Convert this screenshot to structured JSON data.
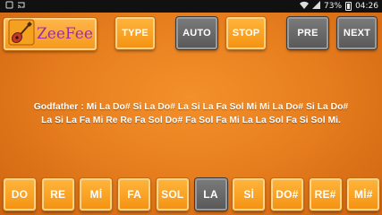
{
  "status_bar": {
    "battery": "73%",
    "time": "04:26"
  },
  "app": {
    "logo_text": "ZeeFee"
  },
  "toolbar": {
    "type_label": "TYPE",
    "auto_label": "AUTO",
    "stop_label": "STOP",
    "pre_label": "PRE",
    "next_label": "NEXT"
  },
  "song": {
    "line1": "Godfather : Mi La Do# Si La Do# La Si La Fa Sol Mi Mi La Do# Si La Do#",
    "line2": "La Si La Fa Mi Re Re Fa Sol Do# Fa Sol Fa Mi La La Sol Fa Si Sol Mi."
  },
  "notes": [
    {
      "label": "DO",
      "active": false
    },
    {
      "label": "RE",
      "active": false
    },
    {
      "label": "Mİ",
      "active": false
    },
    {
      "label": "FA",
      "active": false
    },
    {
      "label": "SOL",
      "active": false
    },
    {
      "label": "LA",
      "active": true
    },
    {
      "label": "Sİ",
      "active": false
    },
    {
      "label": "DO#",
      "active": false
    },
    {
      "label": "RE#",
      "active": false
    },
    {
      "label": "Mİ#",
      "active": false
    }
  ],
  "colors": {
    "background": "#e87f1f",
    "button_orange": "#f49315",
    "button_gray": "#5a5a5a",
    "active_key": "#5a5a5a",
    "logo_text": "#9b2fa5"
  },
  "icons": {
    "logo": "guitar-icon",
    "status_left": [
      "notification-icon",
      "cast-icon"
    ],
    "status_right": [
      "wifi-icon",
      "signal-icon",
      "battery-icon"
    ]
  }
}
